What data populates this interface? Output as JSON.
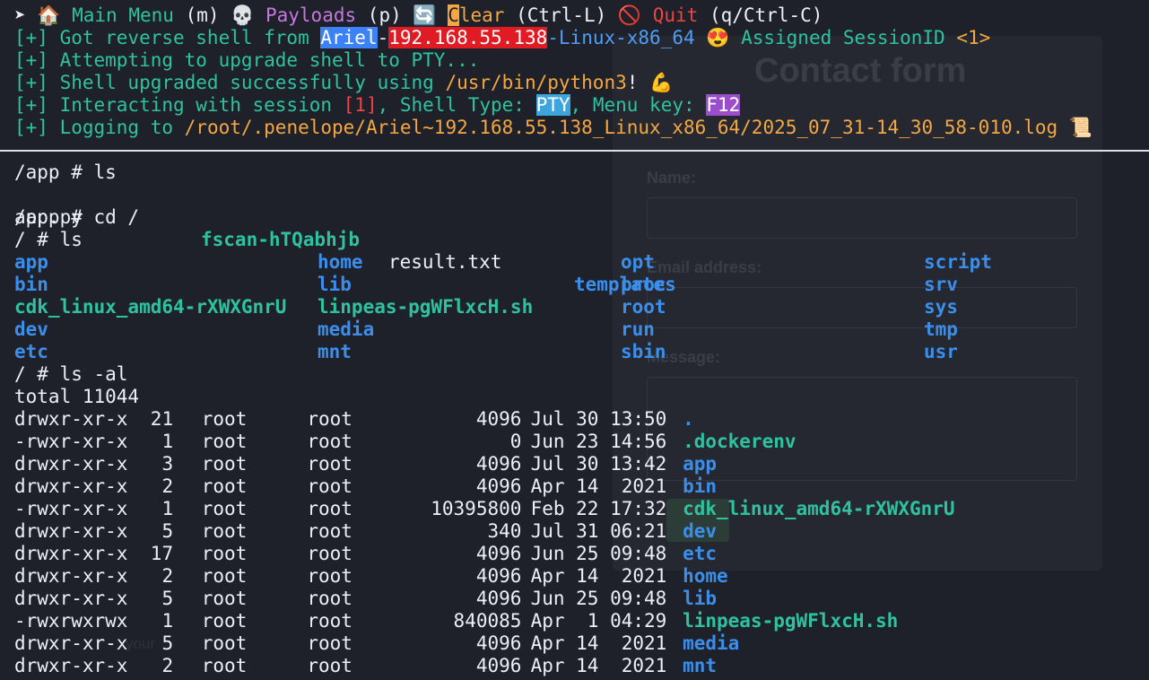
{
  "menu": {
    "arrow": "➤",
    "home_icon": "🏠",
    "main_menu": "Main Menu",
    "main_key": "(m)",
    "skull_icon": "💀",
    "payloads": "Payloads",
    "payloads_key": "(p)",
    "refresh_icon": "🔄",
    "clear_first": "C",
    "clear_rest": "lear",
    "clear_key": "(Ctrl-L)",
    "no_icon": "🚫",
    "quit": "Quit",
    "quit_key": "(q/Ctrl-C)"
  },
  "log": {
    "l1_prefix": "[+] Got reverse shell from ",
    "host_name": "Ariel",
    "dash1": "-",
    "host_ip": "192.168.55.138",
    "host_os": "-Linux-x86_64",
    "emoji1": "😍",
    "assigned": " Assigned SessionID ",
    "session_id": "<1>",
    "l2": "[+] Attempting to upgrade shell to PTY...",
    "l3_prefix": "[+] Shell upgraded successfully using ",
    "l3_path": "/usr/bin/python3",
    "l3_bang": "!",
    "emoji2": "💪",
    "l4_prefix": "[+] Interacting with session ",
    "l4_session": "[1]",
    "l4_mid": ", Shell Type: ",
    "l4_type": "PTY",
    "l4_menu": ", Menu key: ",
    "l4_key": "F12",
    "l5_prefix": "[+] Logging to ",
    "l5_path": "/root/.penelope/Ariel~192.168.55.138_Linux_x86_64/2025_07_31-14_30_58-010.log",
    "emoji3": "📜"
  },
  "shell": {
    "cmd1": "/app # ls",
    "app_files": [
      "app.py",
      "fscan-hTQabhjb",
      "result.txt",
      "templates"
    ],
    "cmd2": "/app # cd /",
    "cmd3": "/ # ls",
    "root_ls": [
      [
        "app",
        "home",
        "opt",
        "script"
      ],
      [
        "bin",
        "lib",
        "proc",
        "srv"
      ],
      [
        "cdk_linux_amd64-rXWXGnrU",
        "linpeas-pgWFlxcH.sh",
        "root",
        "sys"
      ],
      [
        "dev",
        "media",
        "run",
        "tmp"
      ],
      [
        "etc",
        "mnt",
        "sbin",
        "usr"
      ]
    ],
    "cmd4": "/ # ls -al",
    "total": "total 11044",
    "listing": [
      {
        "perm": "drwxr-xr-x",
        "links": "21",
        "owner": "root",
        "group": "root",
        "size": "4096",
        "date": "Jul 30 13:50",
        "name": "."
      },
      {
        "perm": "-rwxr-xr-x",
        "links": "1",
        "owner": "root",
        "group": "root",
        "size": "0",
        "date": "Jun 23 14:56",
        "name": ".dockerenv"
      },
      {
        "perm": "drwxr-xr-x",
        "links": "3",
        "owner": "root",
        "group": "root",
        "size": "4096",
        "date": "Jul 30 13:42",
        "name": "app"
      },
      {
        "perm": "drwxr-xr-x",
        "links": "2",
        "owner": "root",
        "group": "root",
        "size": "4096",
        "date": "Apr 14  2021",
        "name": "bin"
      },
      {
        "perm": "-rwxr-xr-x",
        "links": "1",
        "owner": "root",
        "group": "root",
        "size": "10395800",
        "date": "Feb 22 17:32",
        "name": "cdk_linux_amd64-rXWXGnrU"
      },
      {
        "perm": "drwxr-xr-x",
        "links": "5",
        "owner": "root",
        "group": "root",
        "size": "340",
        "date": "Jul 31 06:21",
        "name": "dev"
      },
      {
        "perm": "drwxr-xr-x",
        "links": "17",
        "owner": "root",
        "group": "root",
        "size": "4096",
        "date": "Jun 25 09:48",
        "name": "etc"
      },
      {
        "perm": "drwxr-xr-x",
        "links": "2",
        "owner": "root",
        "group": "root",
        "size": "4096",
        "date": "Apr 14  2021",
        "name": "home"
      },
      {
        "perm": "drwxr-xr-x",
        "links": "5",
        "owner": "root",
        "group": "root",
        "size": "4096",
        "date": "Jun 25 09:48",
        "name": "lib"
      },
      {
        "perm": "-rwxrwxrwx",
        "links": "1",
        "owner": "root",
        "group": "root",
        "size": "840085",
        "date": "Apr  1 04:29",
        "name": "linpeas-pgWFlxcH.sh"
      },
      {
        "perm": "drwxr-xr-x",
        "links": "5",
        "owner": "root",
        "group": "root",
        "size": "4096",
        "date": "Apr 14  2021",
        "name": "media"
      },
      {
        "perm": "drwxr-xr-x",
        "links": "2",
        "owner": "root",
        "group": "root",
        "size": "4096",
        "date": "Apr 14  2021",
        "name": "mnt"
      }
    ]
  },
  "background_page": {
    "title": "Contact form",
    "name_label": "Name:",
    "email_label": "Email address:",
    "message_label": "Message:",
    "footer_text": "your"
  },
  "colors": {
    "background": "#1e2129",
    "green": "#2ec2a0",
    "dir_blue": "#3b8eea",
    "orange": "#f5a742",
    "purple": "#c678dd",
    "red": "#ef4444"
  }
}
